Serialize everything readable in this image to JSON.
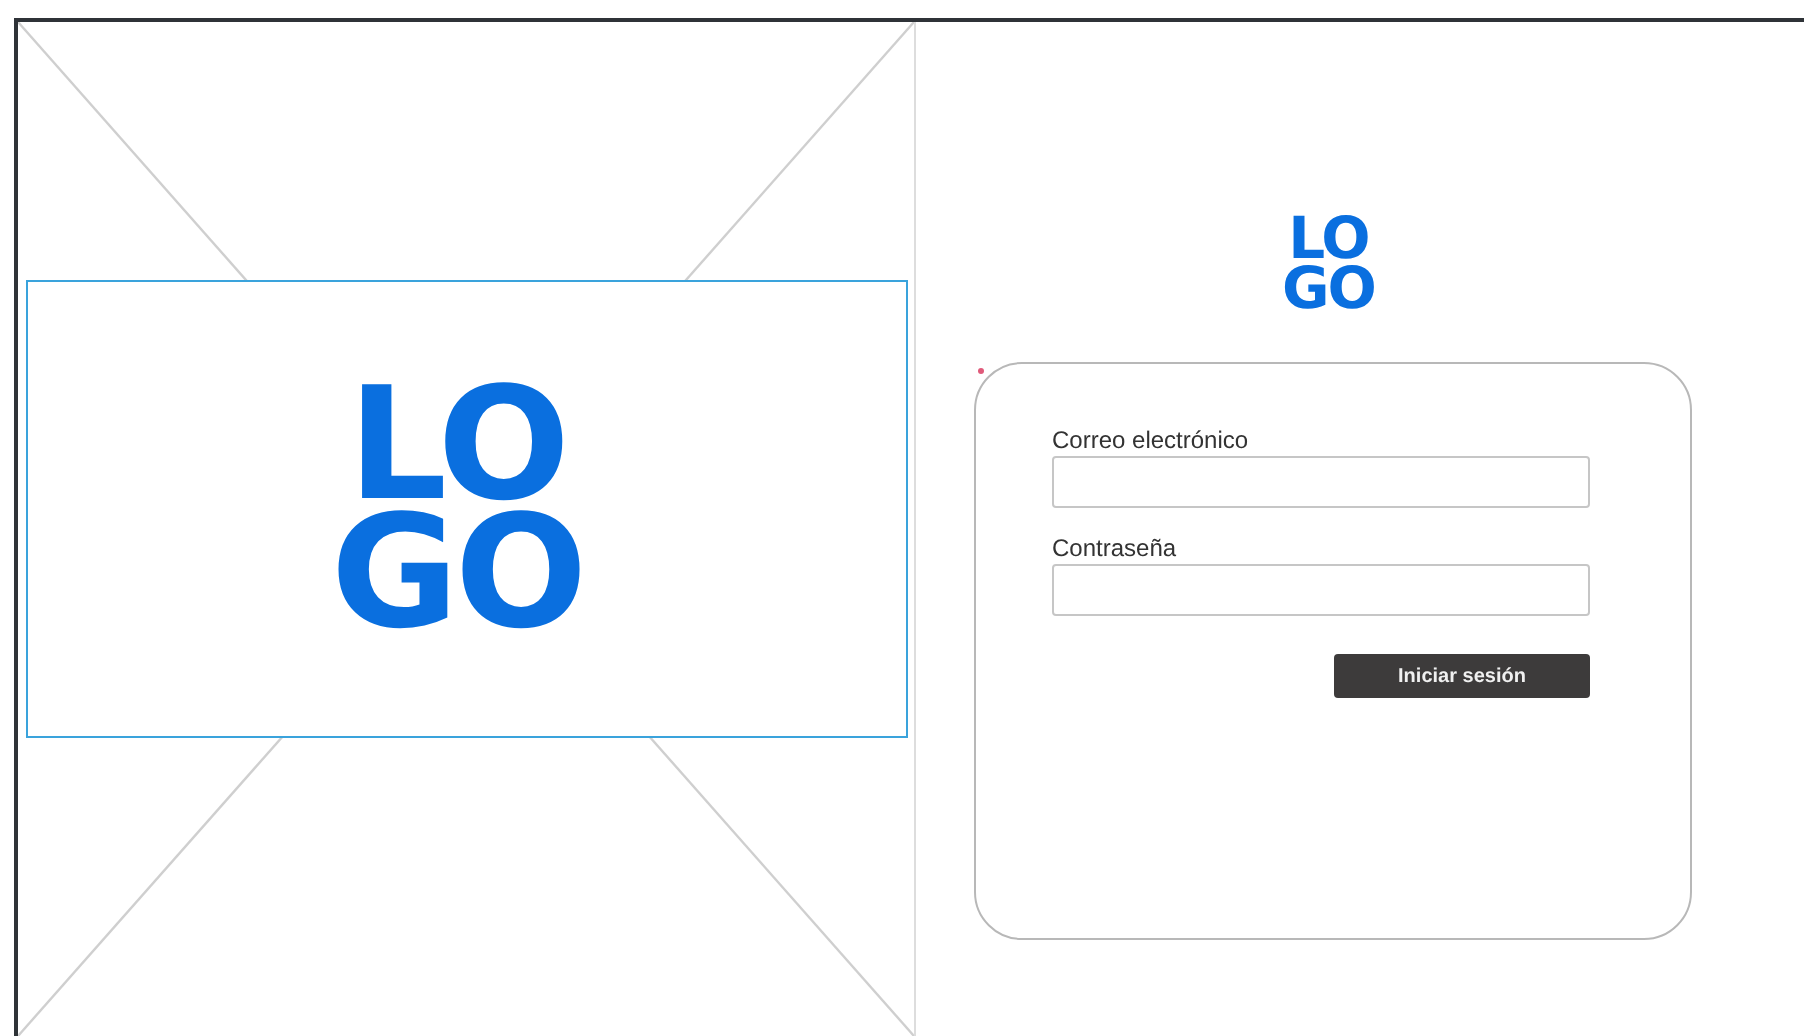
{
  "hero": {
    "logo_lines": [
      "LO",
      "GO"
    ]
  },
  "login": {
    "logo_lines": [
      "LO",
      "GO"
    ],
    "fields": [
      {
        "label": "Correo electrónico"
      },
      {
        "label": "Contraseña"
      }
    ],
    "button": "Iniciar sesión"
  }
}
